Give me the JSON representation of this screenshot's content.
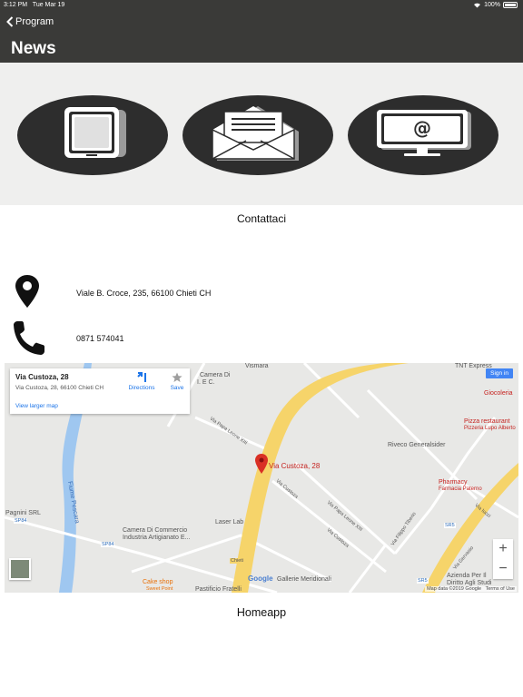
{
  "status": {
    "time": "3:12 PM",
    "date": "Tue Mar 19",
    "battery": "100%"
  },
  "nav": {
    "back_label": "Program",
    "title": "News"
  },
  "contact_heading": "Contattaci",
  "contacts": {
    "address": "Viale B. Croce, 235, 66100 Chieti CH",
    "phone": "0871 574041"
  },
  "map": {
    "card_title": "Via Custoza, 28",
    "card_address": "Via Custoza, 28, 66100 Chieti CH",
    "view_larger": "View larger map",
    "directions": "Directions",
    "save": "Save",
    "signin": "Sign in",
    "pin_label": "Via Custoza, 28",
    "zoom_in": "+",
    "zoom_out": "−",
    "google": "Google",
    "map_data": "Map data ©2019 Google",
    "terms": "Terms of Use",
    "places": {
      "vismara": "Vismara",
      "tnt": "TNT Express",
      "giocoleria": "Giocoleria",
      "pizza": "Pizza restaurant",
      "pizza_sub": "Pizzeria Lupo Alberto",
      "riveco": "Riveco Generalsider",
      "pharmacy": "Pharmacy",
      "pharmacy_sub": "Farmacia Paterno",
      "fiume": "Fiume Pescara",
      "pagnini": "Pagnini SRL",
      "camera1": "Camera Di Commercio",
      "camera2": "Industria Artigianato E...",
      "laserlab": "Laser Lab",
      "cakeshop": "Cake shop",
      "cakeshop_sub": "Sweet Point",
      "pastificio": "Pastificio Fratelli",
      "meridionali": "Gallerie Meridionali",
      "azienda1": "Azienda Per Il",
      "azienda2": "Diritto Agli Studi",
      "camera_top1": "Camera Di",
      "camera_top2": "I. E C.",
      "via_papa": "Via Papa Leone XIII",
      "via_custoza": "Via Custoza",
      "via_papa2": "Via Papa Leone XIII",
      "via_custoza2": "Via Custoza",
      "via_filippo": "Via Filippo Tiberio",
      "via_iucci": "Via Iucci",
      "via_gervasio": "Via Gervasio",
      "sp84a": "SP84",
      "sp84b": "SP84",
      "sr5a": "SR5",
      "sr5b": "SR5",
      "chieti": "Chieti"
    }
  },
  "footer_label": "Homeapp",
  "colors": {
    "header": "#3a3a38",
    "band": "#efefee",
    "oval": "#2d2d2d",
    "road": "#f6d46a",
    "water": "#9fc7f0",
    "pin": "#d93025"
  }
}
